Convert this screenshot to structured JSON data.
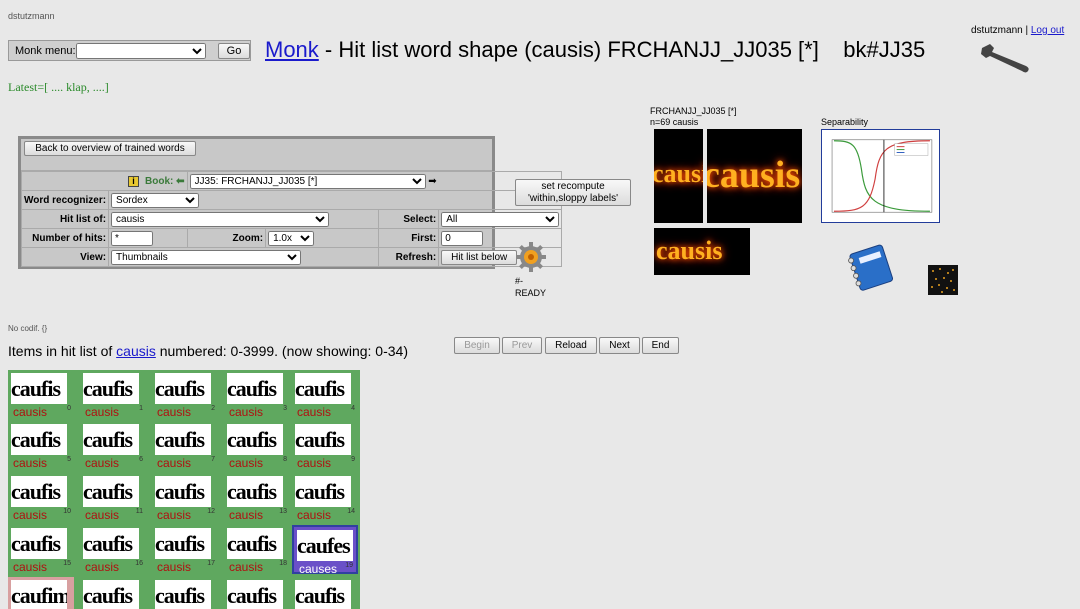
{
  "top_user": "dstutzmann",
  "menu": {
    "label": "Monk menu:",
    "select_value": "",
    "go_label": "Go"
  },
  "title": {
    "link": "Monk",
    "rest": " - Hit list word shape (causis) FRCHANJJ_JJ035 [*]    bk#JJ35"
  },
  "user": {
    "name": "dstutzmann",
    "separator": " | ",
    "logout": "Log out"
  },
  "latest": "Latest=[ .... klap, ....]",
  "panel": {
    "back_button": "Back to overview of trained words",
    "info_icon": "i",
    "book_label": "Book:",
    "book_value": "JJ35: FRCHANJJ_JJ035 [*]",
    "word_recognizer_label": "Word recognizer:",
    "word_recognizer_value": "Sordex",
    "hit_list_label": "Hit list of:",
    "hit_list_value": "causis",
    "select_label": "Select:",
    "select_value": "All",
    "number_hits_label": "Number of hits:",
    "number_hits_value": "*",
    "zoom_label": "Zoom:",
    "zoom_value": "1.0x",
    "first_label": "First:",
    "first_value": "0",
    "view_label": "View:",
    "view_value": "Thumbnails",
    "refresh_label": "Refresh:",
    "refresh_button": "Hit list below"
  },
  "recompute": {
    "line1": "set recompute",
    "line2": "'within,sloppy labels'"
  },
  "status": {
    "line1": "#-",
    "line2": "READY"
  },
  "thumbs": {
    "header1": "FRCHANJJ_JJ035 [*]",
    "header2": "n=69 causis",
    "word": "causis"
  },
  "separability": "Separability",
  "no_codif": "No codif. {}",
  "items_line": {
    "prefix": "Items in hit list of ",
    "link": "causis",
    "suffix": " numbered: 0-3999. (now showing: 0-34)"
  },
  "nav": [
    "Begin",
    "Prev",
    "Reload",
    "Next",
    "End"
  ],
  "hits": [
    {
      "word": "causis",
      "num": "0",
      "glyph": "caufis"
    },
    {
      "word": "causis",
      "num": "1",
      "glyph": "caufis"
    },
    {
      "word": "causis",
      "num": "2",
      "glyph": "caufis"
    },
    {
      "word": "causis",
      "num": "3",
      "glyph": "caufis"
    },
    {
      "word": "causis",
      "num": "4",
      "glyph": "caufis"
    },
    {
      "word": "causis",
      "num": "5",
      "glyph": "caufis"
    },
    {
      "word": "causis",
      "num": "6",
      "glyph": "caufis"
    },
    {
      "word": "causis",
      "num": "7",
      "glyph": "caufis"
    },
    {
      "word": "causis",
      "num": "8",
      "glyph": "caufis"
    },
    {
      "word": "causis",
      "num": "9",
      "glyph": "caufis"
    },
    {
      "word": "causis",
      "num": "10",
      "glyph": "caufis"
    },
    {
      "word": "causis",
      "num": "11",
      "glyph": "caufis"
    },
    {
      "word": "causis",
      "num": "12",
      "glyph": "caufis"
    },
    {
      "word": "causis",
      "num": "13",
      "glyph": "caufis"
    },
    {
      "word": "causis",
      "num": "14",
      "glyph": "caufis"
    },
    {
      "word": "causis",
      "num": "15",
      "glyph": "caufis"
    },
    {
      "word": "causis",
      "num": "16",
      "glyph": "caufis"
    },
    {
      "word": "causis",
      "num": "17",
      "glyph": "caufis"
    },
    {
      "word": "causis",
      "num": "18",
      "glyph": "caufis"
    },
    {
      "word": "causes",
      "num": "19",
      "glyph": "caufes"
    },
    {
      "word": "",
      "num": "",
      "glyph": "caufim"
    },
    {
      "word": "",
      "num": "",
      "glyph": "caufis"
    },
    {
      "word": "",
      "num": "",
      "glyph": "caufis"
    },
    {
      "word": "",
      "num": "",
      "glyph": "caufis"
    },
    {
      "word": "",
      "num": "",
      "glyph": "caufis"
    }
  ]
}
